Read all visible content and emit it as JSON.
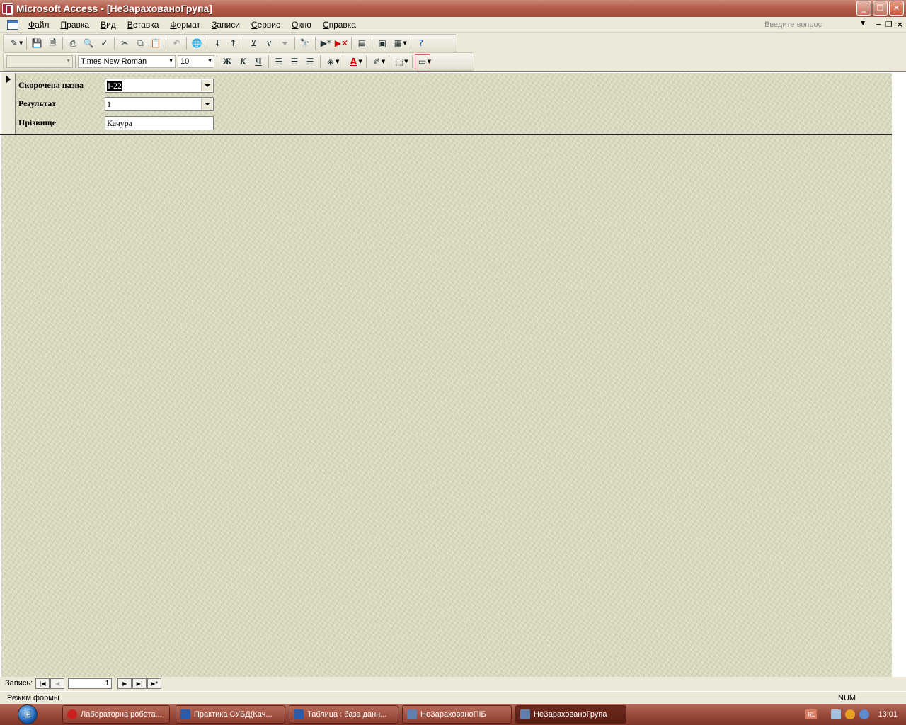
{
  "window": {
    "title": "Microsoft Access - [НеЗарахованоГрупа]",
    "minimize": "_",
    "restore": "❐",
    "close": "✕"
  },
  "menu": {
    "items": [
      "Файл",
      "Правка",
      "Вид",
      "Вставка",
      "Формат",
      "Записи",
      "Сервис",
      "Окно",
      "Справка"
    ],
    "ask_placeholder": "Введите вопрос"
  },
  "format_toolbar": {
    "font_name": "Times New Roman",
    "font_size": "10",
    "bold": "Ж",
    "italic": "К",
    "underline": "Ч"
  },
  "form": {
    "fields": [
      {
        "label": "Скорочена назва",
        "value": "І-22",
        "type": "combo"
      },
      {
        "label": "Результат",
        "value": "1",
        "type": "combo"
      },
      {
        "label": "Прізвище",
        "value": "Качура",
        "type": "text"
      }
    ]
  },
  "navigation": {
    "label": "Запись:",
    "record_number": "1"
  },
  "status": {
    "mode": "Режим формы",
    "num": "NUM"
  },
  "taskbar": {
    "tasks": [
      {
        "label": "Лабораторна робота...",
        "active": false,
        "icon_color": "#cc2020"
      },
      {
        "label": "Практика СУБД(Кач...",
        "active": false,
        "icon_color": "#2a5db0"
      },
      {
        "label": "Таблица : база данн...",
        "active": false,
        "icon_color": "#2a5db0"
      },
      {
        "label": "НеЗарахованоПІБ",
        "active": false,
        "icon_color": "#6080b0"
      },
      {
        "label": "НеЗарахованоГрупа",
        "active": true,
        "icon_color": "#6080b0"
      }
    ],
    "lang": "RL",
    "clock": "13:01"
  }
}
